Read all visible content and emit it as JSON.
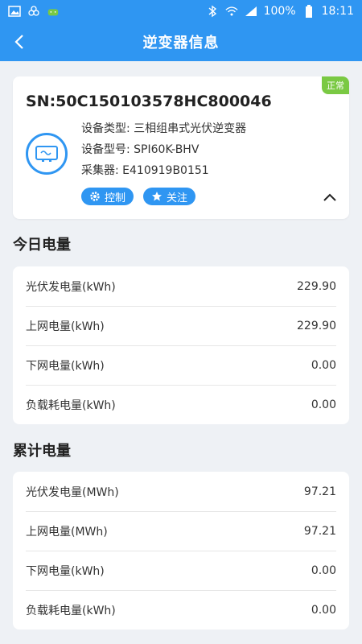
{
  "status_bar": {
    "battery": "100%",
    "time": "18:11"
  },
  "app_bar": {
    "title": "逆变器信息"
  },
  "device": {
    "status": "正常",
    "sn": "SN:50C150103578HC800046",
    "type": "设备类型: 三相组串式光伏逆变器",
    "model": "设备型号: SPI60K-BHV",
    "collector": "采集器: E410919B0151",
    "control_label": "控制",
    "follow_label": "关注"
  },
  "today": {
    "title": "今日电量",
    "rows": [
      {
        "label": "光伏发电量(kWh)",
        "value": "229.90"
      },
      {
        "label": "上网电量(kWh)",
        "value": "229.90"
      },
      {
        "label": "下网电量(kWh)",
        "value": "0.00"
      },
      {
        "label": "负载耗电量(kWh)",
        "value": "0.00"
      }
    ]
  },
  "total": {
    "title": "累计电量",
    "rows": [
      {
        "label": "光伏发电量(MWh)",
        "value": "97.21"
      },
      {
        "label": "上网电量(MWh)",
        "value": "97.21"
      },
      {
        "label": "下网电量(kWh)",
        "value": "0.00"
      },
      {
        "label": "负载耗电量(kWh)",
        "value": "0.00"
      }
    ]
  },
  "colors": {
    "primary": "#2f96f2",
    "status_green": "#7ac943"
  },
  "icons": [
    "image-icon",
    "clover-icon",
    "android-icon",
    "bluetooth-icon",
    "wifi-icon",
    "signal-icon",
    "battery-icon",
    "back-arrow-icon",
    "inverter-icon",
    "gear-icon",
    "star-icon",
    "chevron-up-icon"
  ]
}
